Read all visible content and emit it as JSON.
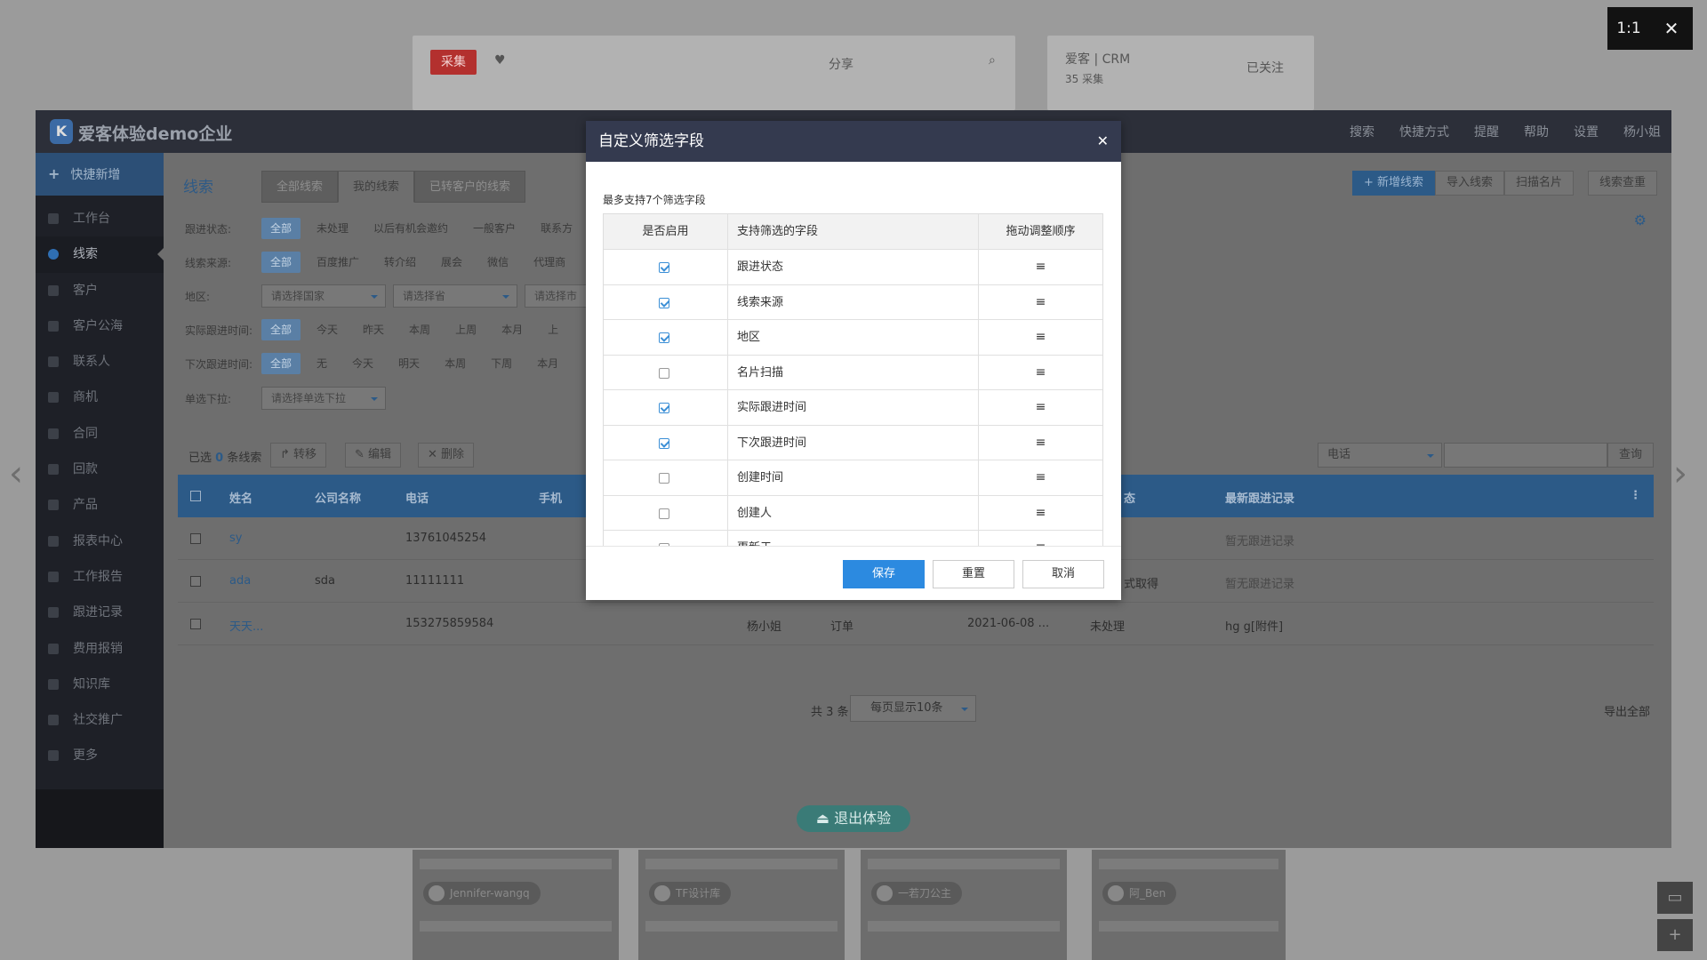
{
  "background": {
    "collect_label": "采集",
    "share_label": "分享",
    "card_title": "爱客 | CRM",
    "card_meta": "35 采集",
    "followed_label": "已关注",
    "thumbs": [
      {
        "author": "Jennifer-wangq"
      },
      {
        "author": "TF设计库"
      },
      {
        "author": "一若刀公主"
      },
      {
        "author": "阿_Ben"
      }
    ]
  },
  "viewer": {
    "ratio_label": "1:1",
    "close_icon": "close-icon"
  },
  "app": {
    "brand": "爱客体验demo企业",
    "topnav": [
      "搜索",
      "快捷方式",
      "提醒",
      "帮助",
      "设置",
      "杨小姐"
    ],
    "quick_add": "快捷新增",
    "sidebar": [
      {
        "label": "工作台",
        "icon": "dashboard-icon"
      },
      {
        "label": "线索",
        "icon": "clue-icon"
      },
      {
        "label": "客户",
        "icon": "customer-icon"
      },
      {
        "label": "客户公海",
        "icon": "pool-icon"
      },
      {
        "label": "联系人",
        "icon": "contact-icon"
      },
      {
        "label": "商机",
        "icon": "opportunity-icon"
      },
      {
        "label": "合同",
        "icon": "contract-icon"
      },
      {
        "label": "回款",
        "icon": "payment-icon"
      },
      {
        "label": "产品",
        "icon": "product-icon"
      },
      {
        "label": "报表中心",
        "icon": "report-icon"
      },
      {
        "label": "工作报告",
        "icon": "work-report-icon"
      },
      {
        "label": "跟进记录",
        "icon": "followup-icon"
      },
      {
        "label": "费用报销",
        "icon": "expense-icon"
      },
      {
        "label": "知识库",
        "icon": "knowledge-icon"
      },
      {
        "label": "社交推广",
        "icon": "share-icon"
      },
      {
        "label": "更多",
        "icon": "more-icon"
      }
    ],
    "page_title": "线索",
    "tabs": [
      "全部线索",
      "我的线索",
      "已转客户的线索"
    ],
    "active_tab": "我的线索",
    "actions": [
      "+ 新增线索",
      "导入线索",
      "扫描名片",
      "线索查重"
    ],
    "filters": [
      {
        "label": "跟进状态:",
        "options": [
          "全部",
          "未处理",
          "以后有机会邀约",
          "一般客户",
          "联系方"
        ]
      },
      {
        "label": "线索来源:",
        "options": [
          "全部",
          "百度推广",
          "转介绍",
          "展会",
          "微信",
          "代理商"
        ]
      },
      {
        "label": "实际跟进时间:",
        "options": [
          "全部",
          "今天",
          "昨天",
          "本周",
          "上周",
          "本月",
          "上"
        ]
      },
      {
        "label": "下次跟进时间:",
        "options": [
          "全部",
          "无",
          "今天",
          "明天",
          "本周",
          "下周",
          "本月"
        ]
      }
    ],
    "region": {
      "label": "地区:",
      "country": "请选择国家",
      "province": "请选择省",
      "city": "请选择市"
    },
    "single_select": {
      "label": "单选下拉:",
      "placeholder": "请选择单选下拉"
    },
    "bulk": {
      "selected_prefix": "已选",
      "selected_count": "0",
      "selected_suffix": "条线索",
      "transfer": "转移",
      "edit": "编辑",
      "delete": "删除"
    },
    "query": {
      "field": "电话",
      "button": "查询"
    },
    "columns": [
      "姓名",
      "公司名称",
      "电话",
      "手机",
      "态",
      "最新跟进记录"
    ],
    "rows": [
      {
        "name": "sy",
        "company": "",
        "phone": "13761045254",
        "owner": "",
        "type": "",
        "date": "",
        "status": "",
        "latest": "暂无跟进记录"
      },
      {
        "name": "ada",
        "company": "sda",
        "phone": "11111111",
        "owner": "",
        "type": "",
        "date": "",
        "status": "式取得",
        "latest": "暂无跟进记录"
      },
      {
        "name": "天天...",
        "company": "",
        "phone": "153275859584",
        "owner": "杨小姐",
        "type": "订单",
        "date": "2021-06-08 ...",
        "status": "未处理",
        "latest": "hg g[附件]"
      }
    ],
    "footer": {
      "total": "共 3 条",
      "page_size": "每页显示10条",
      "export": "导出全部"
    },
    "exit_label": "退出体验"
  },
  "modal": {
    "title": "自定义筛选字段",
    "note": "最多支持7个筛选字段",
    "headers": [
      "是否启用",
      "支持筛选的字段",
      "拖动调整顺序"
    ],
    "fields": [
      {
        "name": "跟进状态",
        "enabled": true
      },
      {
        "name": "线索来源",
        "enabled": true
      },
      {
        "name": "地区",
        "enabled": true
      },
      {
        "name": "名片扫描",
        "enabled": false
      },
      {
        "name": "实际跟进时间",
        "enabled": true
      },
      {
        "name": "下次跟进时间",
        "enabled": true
      },
      {
        "name": "创建时间",
        "enabled": false
      },
      {
        "name": "创建人",
        "enabled": false
      },
      {
        "name": "更新于",
        "enabled": false
      }
    ],
    "drag_glyph": "≡",
    "save": "保存",
    "reset": "重置",
    "cancel": "取消"
  },
  "colors": {
    "accent": "#2c8ae0",
    "modal_header": "#343a4f",
    "check": "#3b8fd6"
  }
}
